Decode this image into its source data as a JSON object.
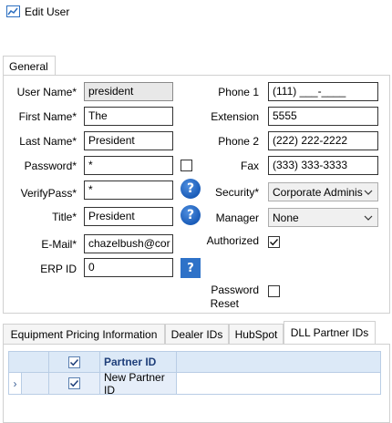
{
  "window": {
    "title": "Edit User"
  },
  "tabs": {
    "general": "General"
  },
  "form": {
    "username_label": "User Name*",
    "username_value": "president",
    "firstname_label": "First Name*",
    "firstname_value": "The",
    "lastname_label": "Last Name*",
    "lastname_value": "President",
    "password_label": "Password*",
    "password_value": "*",
    "verifypass_label": "VerifyPass*",
    "verifypass_value": "*",
    "title_label": "Title*",
    "title_value": "President",
    "email_label": "E-Mail*",
    "email_value": "chazelbush@cor",
    "erpid_label": "ERP ID",
    "erpid_value": "0",
    "phone1_label": "Phone 1",
    "phone1_value": "(111) ___-____",
    "extension_label": "Extension",
    "extension_value": "5555",
    "phone2_label": "Phone 2",
    "phone2_value": "(222) 222-2222",
    "fax_label": "Fax",
    "fax_value": "(333) 333-3333",
    "security_label": "Security*",
    "security_value": "Corporate Adminis",
    "manager_label": "Manager",
    "manager_value": "None",
    "authorized_label": "Authorized",
    "authorized_checked": true,
    "password_reset_label_1": "Password",
    "password_reset_label_2": "Reset",
    "password_reset_checked": false,
    "password_checkbox_checked": false,
    "help_glyph": "?"
  },
  "bottom_tabs": {
    "items": [
      {
        "label": "Equipment Pricing Information"
      },
      {
        "label": "Dealer IDs"
      },
      {
        "label": "HubSpot"
      },
      {
        "label": "DLL Partner IDs",
        "active": true
      }
    ]
  },
  "grid": {
    "header": {
      "checked": true,
      "column": "Partner ID"
    },
    "rows": [
      {
        "indicator": "›",
        "checked": true,
        "partner_id": "New Partner ID"
      }
    ]
  },
  "colors": {
    "help_blue": "#2e72c8",
    "grid_header_bg": "#dce9f7",
    "grid_header_text": "#1f3f7a"
  }
}
